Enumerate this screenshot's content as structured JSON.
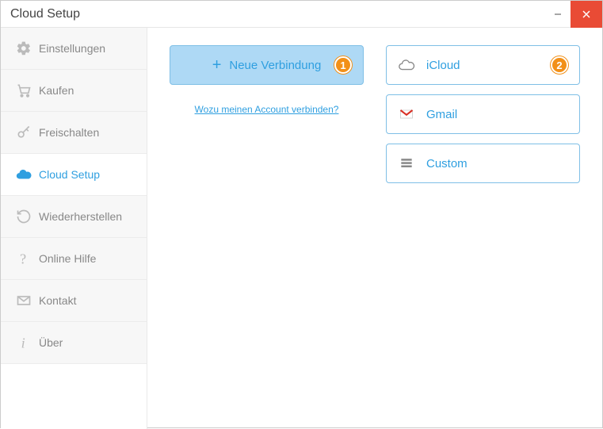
{
  "window": {
    "title": "Cloud Setup"
  },
  "sidebar": {
    "items": [
      {
        "label": "Einstellungen",
        "icon": "gear-icon"
      },
      {
        "label": "Kaufen",
        "icon": "cart-icon"
      },
      {
        "label": "Freischalten",
        "icon": "key-icon"
      },
      {
        "label": "Cloud Setup",
        "icon": "cloud-icon",
        "active": true
      },
      {
        "label": "Wiederherstellen",
        "icon": "restore-icon"
      },
      {
        "label": "Online Hilfe",
        "icon": "help-icon"
      },
      {
        "label": "Kontakt",
        "icon": "mail-icon"
      },
      {
        "label": "Über",
        "icon": "info-icon"
      }
    ]
  },
  "main": {
    "new_connection_label": "Neue Verbindung",
    "info_link": "Wozu meinen Account verbinden?",
    "cloud_options": [
      {
        "label": "iCloud",
        "icon": "icloud-icon"
      },
      {
        "label": "Gmail",
        "icon": "gmail-icon"
      },
      {
        "label": "Custom",
        "icon": "server-icon"
      }
    ]
  },
  "callouts": {
    "one": "1",
    "two": "2"
  }
}
